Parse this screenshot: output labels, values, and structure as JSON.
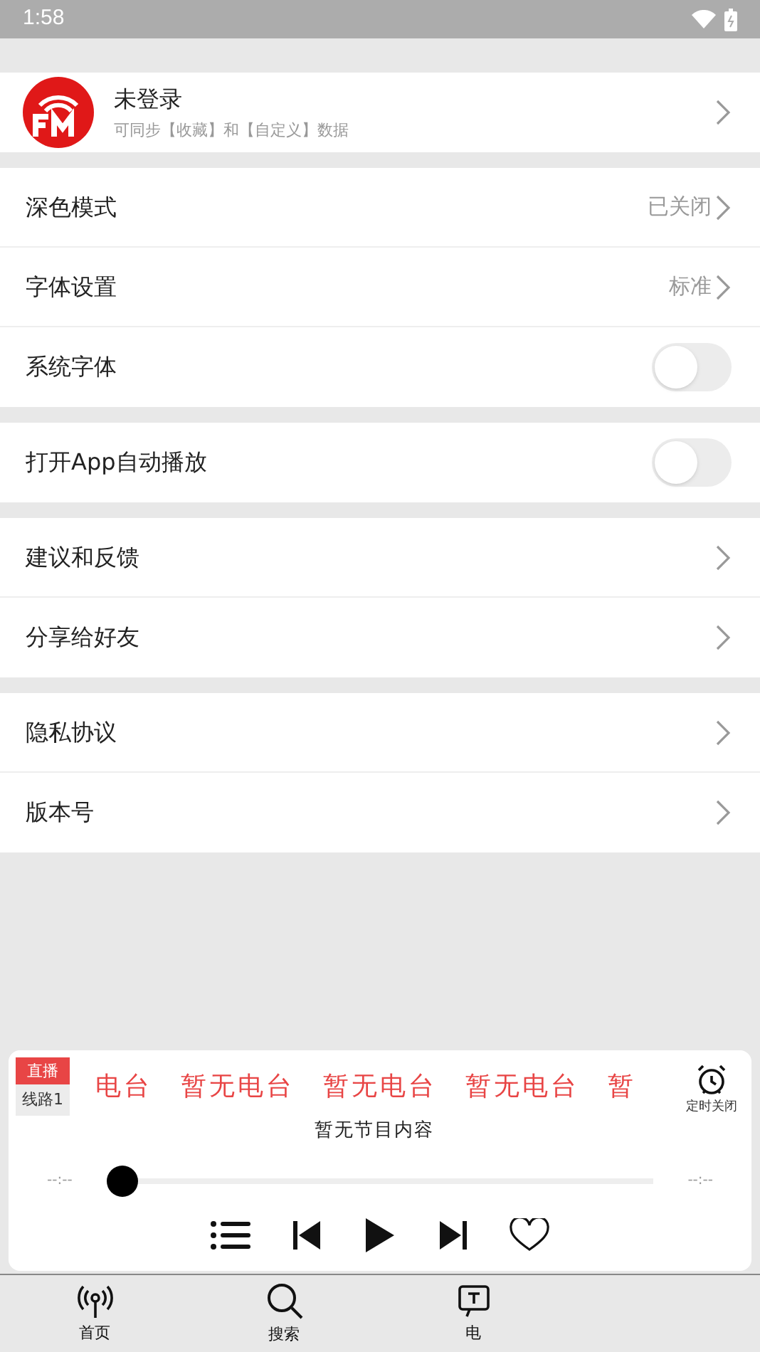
{
  "status_bar": {
    "time": "1:58"
  },
  "profile": {
    "name": "未登录",
    "subtitle": "可同步【收藏】和【自定义】数据"
  },
  "sections": [
    [
      {
        "kind": "value",
        "label": "深色模式",
        "value": "已关闭"
      },
      {
        "kind": "value",
        "label": "字体设置",
        "value": "标准"
      },
      {
        "kind": "switch",
        "label": "系统字体",
        "on": false
      }
    ],
    [
      {
        "kind": "switch",
        "label": "打开App自动播放",
        "on": false
      }
    ],
    [
      {
        "kind": "link",
        "label": "建议和反馈"
      },
      {
        "kind": "link",
        "label": "分享给好友"
      }
    ],
    [
      {
        "kind": "link",
        "label": "隐私协议"
      },
      {
        "kind": "link",
        "label": "版本号"
      }
    ]
  ],
  "player": {
    "live_badge": "直播",
    "line_badge": "线路1",
    "marquee": [
      "电台",
      "暂无电台",
      "暂无电台",
      "暂无电台",
      "暂"
    ],
    "program": "暂无节目内容",
    "timer_label": "定时关闭",
    "elapsed": "--:--",
    "total": "--:--",
    "level": 0,
    "favorite": false
  },
  "bottom_nav": [
    {
      "label": "首页",
      "kind": "antenna",
      "selected": false
    },
    {
      "label": "搜索",
      "kind": "search",
      "selected": false
    },
    {
      "label": "电",
      "kind": "tv",
      "selected": false
    }
  ]
}
